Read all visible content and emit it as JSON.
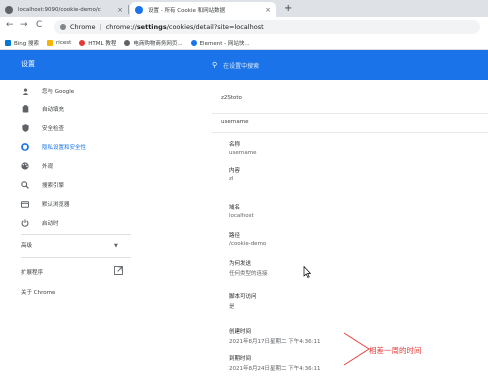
{
  "tabs": [
    {
      "title": "localhost:9090/cookie-demo/c",
      "close": "×",
      "fav_color": "#5f6368"
    },
    {
      "title": "设置 - 所有 Cookie 和网站数据",
      "close": "×",
      "fav_color": "#1a73e8"
    }
  ],
  "new_tab": "+",
  "toolbar": {
    "back": "←",
    "forward": "→",
    "reload": "C",
    "browser_label": "Chrome",
    "url_prefix": "chrome://",
    "url_host": "settings",
    "url_path": "/cookies/detail?site=localhost"
  },
  "bookmarks": [
    {
      "label": "Bing 搜索",
      "color": "#0078d4"
    },
    {
      "label": "ricest",
      "color": "#f4b400"
    },
    {
      "label": "HTML 教程",
      "color": "#e53935"
    },
    {
      "label": "电商购物商务网页...",
      "color": "#5f6368"
    },
    {
      "label": "Element - 网站快...",
      "color": "#1a73e8"
    }
  ],
  "settings": {
    "title": "设置",
    "search_placeholder": "在设置中搜索"
  },
  "sidebar": {
    "items": [
      {
        "label": "您与 Google",
        "icon": "person-icon"
      },
      {
        "label": "自动填充",
        "icon": "clipboard-icon"
      },
      {
        "label": "安全检查",
        "icon": "shield-icon"
      },
      {
        "label": "隐私设置和安全性",
        "icon": "privacy-shield-icon",
        "active": true
      },
      {
        "label": "外观",
        "icon": "palette-icon"
      },
      {
        "label": "搜索引擎",
        "icon": "search-icon"
      },
      {
        "label": "默认浏览器",
        "icon": "browser-icon"
      },
      {
        "label": "启动时",
        "icon": "power-icon"
      }
    ],
    "advanced": "高级",
    "extensions": "扩展程序",
    "about": "关于 Chrome"
  },
  "cookies": {
    "first": "z2Stoto",
    "second": "username",
    "fields": [
      {
        "label": "名称",
        "value": "username"
      },
      {
        "label": "内容",
        "value": "zl"
      },
      {
        "label": "域名",
        "value": "localhost"
      },
      {
        "label": "路径",
        "value": "/cookie-demo"
      },
      {
        "label": "为何发送",
        "value": "任何类型的连接"
      },
      {
        "label": "脚本可访问",
        "value": "是"
      },
      {
        "label": "创建时间",
        "value": "2021年8月17日星期二 下午4:36:11"
      },
      {
        "label": "到期时间",
        "value": "2021年8月24日星期二 下午4:36:11"
      }
    ]
  },
  "annotation": {
    "text": "相差一周的时间",
    "color": "#e53935"
  }
}
